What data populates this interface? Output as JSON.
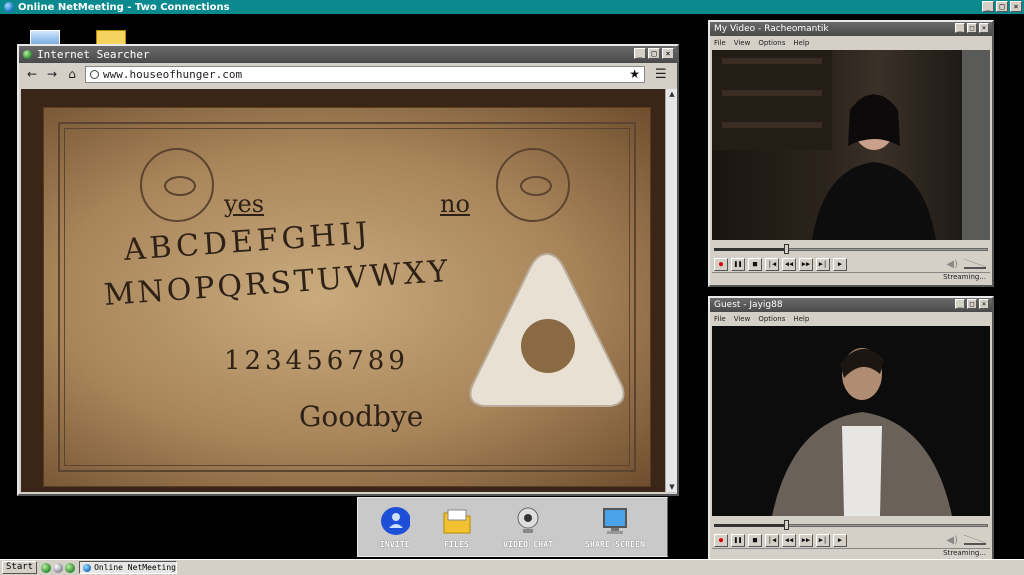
{
  "app": {
    "title": "Online NetMeeting - Two Connections"
  },
  "browser": {
    "title": "Internet Searcher",
    "url": "www.houseofhunger.com",
    "board": {
      "yes": "yes",
      "no": "no",
      "row1": "ABCDEFGHIJ",
      "row2": "MNOPQRSTUVWXY",
      "numbers": "123456789",
      "goodbye": "Goodbye"
    }
  },
  "my_video": {
    "title": "My Video - Racheomantik",
    "menu": [
      "File",
      "View",
      "Options",
      "Help"
    ],
    "status": "Streaming..."
  },
  "guest_video": {
    "title": "Guest - Jayig88",
    "menu": [
      "File",
      "View",
      "Options",
      "Help"
    ],
    "status": "Streaming..."
  },
  "toolbar": {
    "invite": "INVITE",
    "files": "FILES",
    "video_chat": "VIDEO CHAT",
    "share_screen": "SHARE SCREEN"
  },
  "taskbar": {
    "start": "Start",
    "task": "Online NetMeeting"
  },
  "colors": {
    "titlebar": "#0a8a8f",
    "record": "#dd0000",
    "invite_icon": "#1d4fd8"
  }
}
